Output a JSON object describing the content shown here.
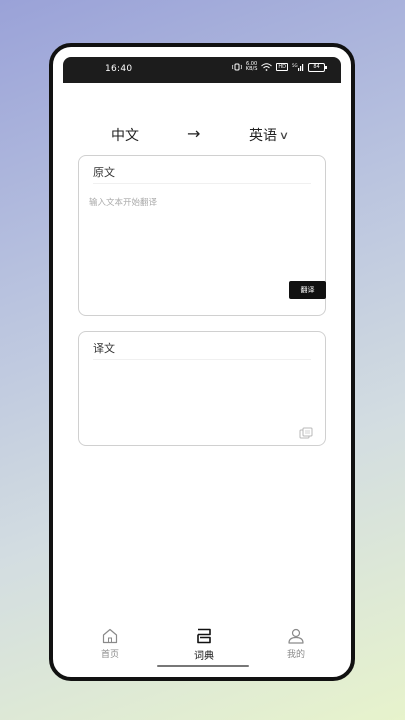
{
  "status_bar": {
    "time": "16:40",
    "net_speed_value": "6.00",
    "net_speed_unit": "KB/S",
    "hd_label": "HD",
    "signal_label": "5G",
    "battery_level": "84"
  },
  "language_bar": {
    "source_language": "中文",
    "target_language": "英语",
    "arrow_icon": "arrow-right-icon",
    "dropdown_icon": "chevron-down-icon"
  },
  "source_card": {
    "title": "原文",
    "placeholder": "输入文本开始翻译",
    "value": "",
    "translate_button": "翻译"
  },
  "target_card": {
    "title": "译文",
    "value": "",
    "copy_icon": "copy-icon"
  },
  "tab_bar": {
    "active": "词典",
    "tabs": [
      {
        "label": "首页",
        "icon": "home-icon"
      },
      {
        "label": "词典",
        "icon": "dictionary-icon"
      },
      {
        "label": "我的",
        "icon": "profile-icon"
      }
    ]
  }
}
